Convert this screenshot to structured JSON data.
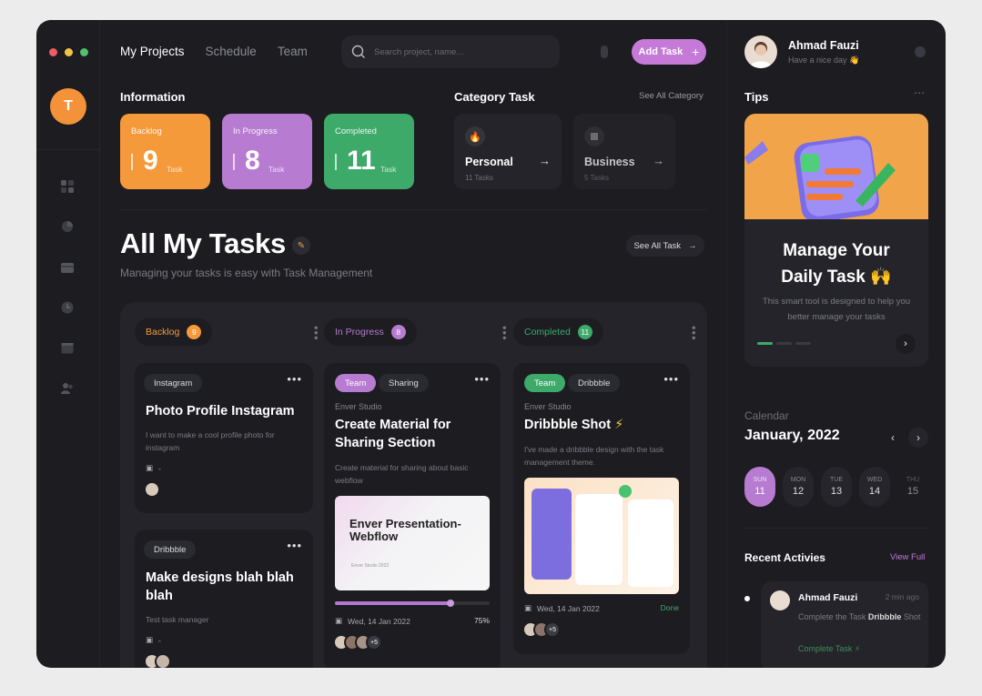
{
  "nav": {
    "tabs": [
      "My Projects",
      "Schedule",
      "Team"
    ],
    "search_placeholder": "Search project, name...",
    "add_task": "Add Task",
    "logo_letter": "T"
  },
  "colors": {
    "orange": "#f59a3a",
    "purple": "#b77bd1",
    "green": "#3daa6a",
    "red_dot": "#ee5e5e",
    "yellow_dot": "#f4c344",
    "green_dot": "#4fc06e"
  },
  "information": {
    "title": "Information",
    "cards": [
      {
        "label": "Backlog",
        "count": "9",
        "unit": "Task"
      },
      {
        "label": "In Progress",
        "count": "8",
        "unit": "Task"
      },
      {
        "label": "Completed",
        "count": "11",
        "unit": "Task"
      }
    ]
  },
  "category": {
    "title": "Category Task",
    "see_all": "See All Category",
    "items": [
      {
        "name": "Personal",
        "count": "11 Tasks",
        "icon": "fire-icon"
      },
      {
        "name": "Business",
        "count": "5 Tasks",
        "icon": "building-icon"
      }
    ]
  },
  "tasks_header": {
    "title": "All My Tasks",
    "subtitle": "Managing your tasks is easy with Task Management",
    "see_all": "See All Task"
  },
  "columns": [
    {
      "label": "Backlog",
      "count": "9"
    },
    {
      "label": "In Progress",
      "count": "8"
    },
    {
      "label": "Completed",
      "count": "11"
    }
  ],
  "cards": {
    "backlog1": {
      "tag": "Instagram",
      "title": "Photo Profile Instagram",
      "desc": "I want to make a cool profile photo for instagram",
      "date": "-"
    },
    "backlog2": {
      "tag": "Dribbble",
      "title": "Make designs blah blah blah",
      "desc": "Test task manager",
      "date": "-"
    },
    "progress1": {
      "tags": [
        "Team",
        "Sharing"
      ],
      "studio": "Enver Studio",
      "title": "Create Material for Sharing Section",
      "desc": "Create material for sharing about basic webflow",
      "image_text": "Enver Presentation-Webflow",
      "image_sub": "Enver Studio 2022",
      "progress": 75,
      "progress_text": "75%",
      "date": "Wed, 14 Jan 2022",
      "more": "+5"
    },
    "done1": {
      "tags": [
        "Team",
        "Dribbble"
      ],
      "studio": "Enver Studio",
      "title": "Dribbble Shot",
      "desc": "I've made a dribbble design with the task management theme.",
      "date": "Wed, 14 Jan 2022",
      "status": "Done",
      "more": "+5"
    }
  },
  "user": {
    "name": "Ahmad Fauzi",
    "greeting": "Have a nice day 👋"
  },
  "tips": {
    "title": "Tips",
    "heading1": "Manage Your",
    "heading2": "Daily Task 🙌",
    "text": "This smart tool is designed to help you better manage your tasks"
  },
  "calendar": {
    "label": "Calendar",
    "month": "January, 2022",
    "days": [
      {
        "dow": "SUN",
        "num": "11"
      },
      {
        "dow": "MON",
        "num": "12"
      },
      {
        "dow": "TUE",
        "num": "13"
      },
      {
        "dow": "WED",
        "num": "14"
      },
      {
        "dow": "THU",
        "num": "15"
      }
    ]
  },
  "recent": {
    "title": "Recent Activies",
    "view_full": "View Full",
    "item": {
      "name": "Ahmad Fauzi",
      "time": "2 min ago",
      "desc_pre": "Complete the Task ",
      "desc_bold": "Dribbble",
      "desc_post": " Shot",
      "link": "Complete Task ⚡"
    }
  }
}
